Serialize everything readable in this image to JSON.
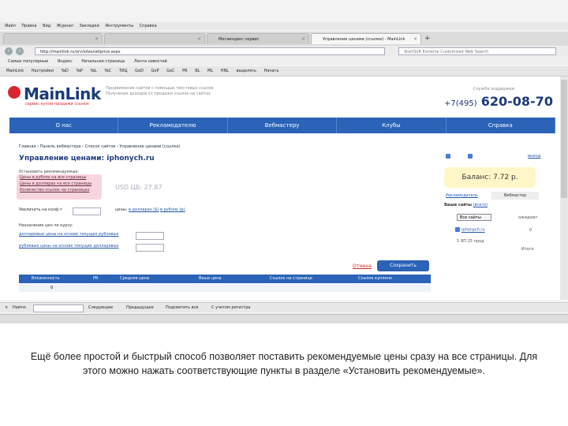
{
  "browser": {
    "menu": [
      "Файл",
      "Правка",
      "Вид",
      "Журнал",
      "Закладки",
      "Инструменты",
      "Справка"
    ],
    "tabs": [
      {
        "label": "",
        "active": false
      },
      {
        "label": "Мегаиндекс сервис",
        "active": false
      },
      {
        "label": "Управление ценами (ссылки) - MainLink",
        "active": true
      }
    ],
    "new_tab": "+",
    "url": "http://mainlink.ru/xrv/sites/setprice.aspx",
    "search_placeholder": "StartSoft Extreme Customized Web Search",
    "bookmarks": [
      "Самые популярные",
      "Яндекс",
      "Начальная страница",
      "Лента новостей"
    ],
    "toolbar2": [
      "MainLink",
      "Настройки",
      "YaD",
      "YaP",
      "YaL",
      "YaC",
      "ТИЦ",
      "GoD",
      "GoP",
      "GoC",
      "PR",
      "BL",
      "ML",
      "HNL",
      "выделять",
      "Начать"
    ]
  },
  "site": {
    "logo_text": "MainLink",
    "logo_tagline": "сервис купли-продажи ссылок",
    "slogan_line1": "Продвижение сайтов с помощью текстовых ссылок",
    "slogan_line2": "Получение доходов от продажи ссылок на сайтах",
    "support_label": "Служба поддержки",
    "phone_code": "+7(495)",
    "phone_number": "620-08-70",
    "nav": [
      "О нас",
      "Рекламодателю",
      "Вебмастеру",
      "Клубы",
      "Справка"
    ]
  },
  "main": {
    "breadcrumb": "Главная › Панель вебмастера › Список сайтов › Управление ценами (ссылки)",
    "title": "Управление ценами: iphonych.ru",
    "set_recommended_label": "Установить рекомендуемые:",
    "highlight_links": [
      "Цены в рублях на все страницы",
      "Цены в долларах на все страницы",
      "Количество ссылок на страницах"
    ],
    "usd_rate": "USD ЦБ: 27.87",
    "raise_label": "Увеличить на коэф-т",
    "prices_label": "цены:",
    "price_dollars_link": "в долларах ($)",
    "price_rubles_link": "в рублях (р)",
    "course_label": "Назначение цен по курсу:",
    "course_link1": "долларовые цены на основе текущих рублевых",
    "course_link2": "рублевые цены на основе текущих долларовых",
    "cancel": "Отмена",
    "save": "Сохранить",
    "table_headers": [
      "Вложенность",
      "PR",
      "Средняя цена",
      "Ваша цена",
      "Ссылок на странице",
      "Ссылок куплено"
    ],
    "first_row_value": "0"
  },
  "right_panel": {
    "exit": "выход",
    "balance": "Баланс: 7.72 р.",
    "tab_advertiser": "Рекламодатель",
    "tab_webmaster": "Вебмастер",
    "sites_label": "Ваши сайты",
    "sites_count": "(всего)",
    "select_value": "Все сайты",
    "site_name": "iphonych.ru",
    "site_meta": "5 ЯП 25 прод",
    "stat1": "ожидают",
    "stat2": "0",
    "stat3": "Итого"
  },
  "findbar": {
    "find_label": "Найти:",
    "next": "Следующее",
    "prev": "Предыдущее",
    "highlight_all": "Подсветить все",
    "match_case": "С учетом регистра"
  },
  "caption": "Ещё более простой и быстрый способ позволяет поставить рекомендуемые цены сразу на все страницы. Для этого можно нажать соответствующие пункты в разделе «Установить рекомендуемые»."
}
